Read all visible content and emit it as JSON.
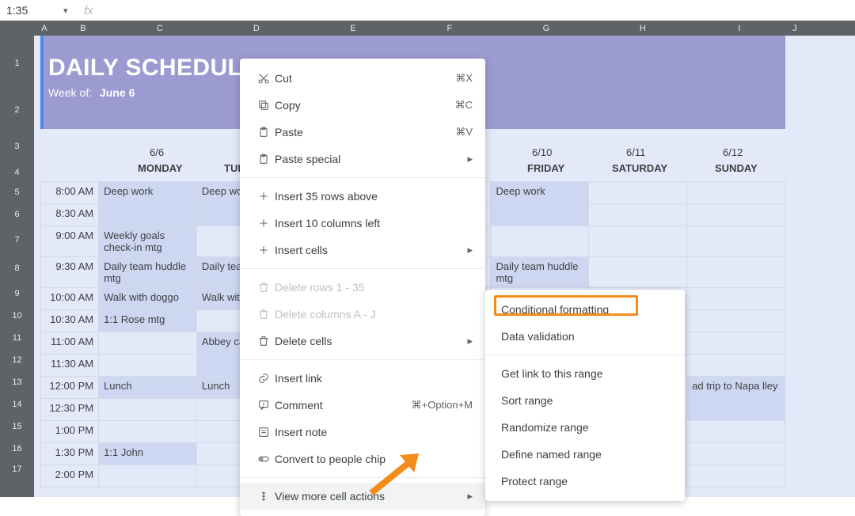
{
  "name_box": "1:35",
  "fx_symbol": "fx",
  "fx_value": "",
  "columns": [
    {
      "letter": "A",
      "w": 26
    },
    {
      "letter": "B",
      "w": 72
    },
    {
      "letter": "C",
      "w": 122
    },
    {
      "letter": "D",
      "w": 122
    },
    {
      "letter": "E",
      "w": 122
    },
    {
      "letter": "F",
      "w": 122
    },
    {
      "letter": "G",
      "w": 122
    },
    {
      "letter": "H",
      "w": 122
    },
    {
      "letter": "I",
      "w": 122
    },
    {
      "letter": "J",
      "w": 18
    }
  ],
  "row_headers": [
    {
      "r": "1",
      "h": 70
    },
    {
      "r": "2",
      "h": 48
    },
    {
      "r": "3",
      "h": 44
    },
    {
      "r": "4",
      "h": 22
    },
    {
      "r": "5",
      "h": 28
    },
    {
      "r": "6",
      "h": 28
    },
    {
      "r": "7",
      "h": 36
    },
    {
      "r": "8",
      "h": 36
    },
    {
      "r": "9",
      "h": 28
    },
    {
      "r": "10",
      "h": 28
    },
    {
      "r": "11",
      "h": 28
    },
    {
      "r": "12",
      "h": 28
    },
    {
      "r": "13",
      "h": 28
    },
    {
      "r": "14",
      "h": 28
    },
    {
      "r": "15",
      "h": 28
    },
    {
      "r": "16",
      "h": 28
    },
    {
      "r": "17",
      "h": 24
    }
  ],
  "header": {
    "title": "DAILY SCHEDULE",
    "week_of_label": "Week of:",
    "week_of_value": "June 6"
  },
  "dates": [
    "6/6",
    "6/10",
    "6/11",
    "6/12"
  ],
  "days": [
    "MONDAY",
    "TUE",
    "FRIDAY",
    "SATURDAY",
    "SUNDAY"
  ],
  "times": [
    "8:00 AM",
    "8:30 AM",
    "9:00 AM",
    "9:30 AM",
    "10:00 AM",
    "10:30 AM",
    "11:00 AM",
    "11:30 AM",
    "12:00 PM",
    "12:30 PM",
    "1:00 PM",
    "1:30 PM",
    "2:00 PM"
  ],
  "mon": [
    "Deep work",
    "",
    "Weekly goals check-in mtg",
    "Daily team huddle mtg",
    "Walk with doggo",
    "1:1 Rose mtg",
    "",
    "",
    "Lunch",
    "",
    "",
    "1:1 John",
    ""
  ],
  "tue": [
    "Deep wo",
    "",
    "",
    "Daily tea mtg",
    "Walk wit",
    "",
    "Abbey ca progress",
    "",
    "Lunch",
    "",
    "",
    "",
    ""
  ],
  "fri": [
    "Deep work",
    "",
    "",
    "Daily team huddle mtg",
    "",
    "",
    "",
    "",
    "",
    "",
    "",
    "",
    ""
  ],
  "sun_overlay": "ad trip to Napa lley",
  "context_menu": {
    "items": [
      {
        "icon": "cut",
        "label": "Cut",
        "shortcut": "⌘X"
      },
      {
        "icon": "copy",
        "label": "Copy",
        "shortcut": "⌘C"
      },
      {
        "icon": "paste",
        "label": "Paste",
        "shortcut": "⌘V"
      },
      {
        "icon": "paste",
        "label": "Paste special",
        "submenu": true
      },
      {
        "sep": true
      },
      {
        "icon": "plus",
        "label": "Insert 35 rows above"
      },
      {
        "icon": "plus",
        "label": "Insert 10 columns left"
      },
      {
        "icon": "plus",
        "label": "Insert cells",
        "submenu": true
      },
      {
        "sep": true
      },
      {
        "icon": "trash",
        "label": "Delete rows 1 - 35",
        "disabled": true
      },
      {
        "icon": "trash",
        "label": "Delete columns A - J",
        "disabled": true
      },
      {
        "icon": "trash",
        "label": "Delete cells",
        "submenu": true
      },
      {
        "sep": true
      },
      {
        "icon": "link",
        "label": "Insert link"
      },
      {
        "icon": "comment",
        "label": "Comment",
        "shortcut": "⌘+Option+M"
      },
      {
        "icon": "note",
        "label": "Insert note"
      },
      {
        "icon": "chip",
        "label": "Convert to people chip"
      },
      {
        "sep": true
      },
      {
        "icon": "more",
        "label": "View more cell actions",
        "submenu": true,
        "hover": true
      }
    ]
  },
  "sub_menu": {
    "items": [
      {
        "label": "Conditional formatting",
        "highlight": true
      },
      {
        "label": "Data validation"
      },
      {
        "sep": true
      },
      {
        "label": "Get link to this range"
      },
      {
        "label": "Sort range"
      },
      {
        "label": "Randomize range"
      },
      {
        "label": "Define named range"
      },
      {
        "label": "Protect range"
      }
    ]
  },
  "chart_data": {
    "type": "table"
  }
}
